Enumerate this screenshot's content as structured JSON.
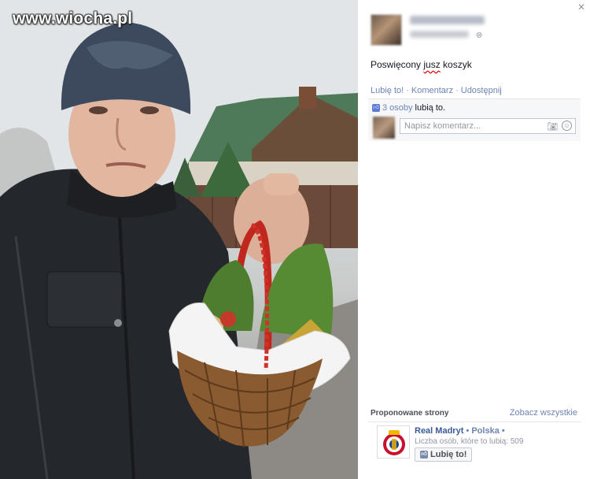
{
  "watermark": "www.wiocha.pl",
  "post": {
    "text_before": "Poswięcony ",
    "text_misspelled": "jusz",
    "text_after": " koszyk",
    "actions": [
      "Lubię to!",
      "Komentarz",
      "Udostępnij"
    ],
    "likes": {
      "count": "3 osoby",
      "suffix": " lubią to."
    },
    "comment_placeholder": "Napisz komentarz..."
  },
  "icons": {
    "close": "close-icon",
    "globe": "globe-icon",
    "thumb": "thumb-up-icon",
    "camera": "camera-icon",
    "emoji": "smile-icon"
  },
  "suggested": {
    "title": "Proponowane strony",
    "see_all": "Zobacz wszystkie",
    "page": {
      "name": "Real Madryt",
      "category": "Polska",
      "meta": "Liczba osób, które to lubią: 509",
      "like_label": "Lubię to!"
    }
  },
  "colors": {
    "link": "#6d84b4",
    "page_name": "#3b5998",
    "misspell_underline": "#e00000"
  }
}
